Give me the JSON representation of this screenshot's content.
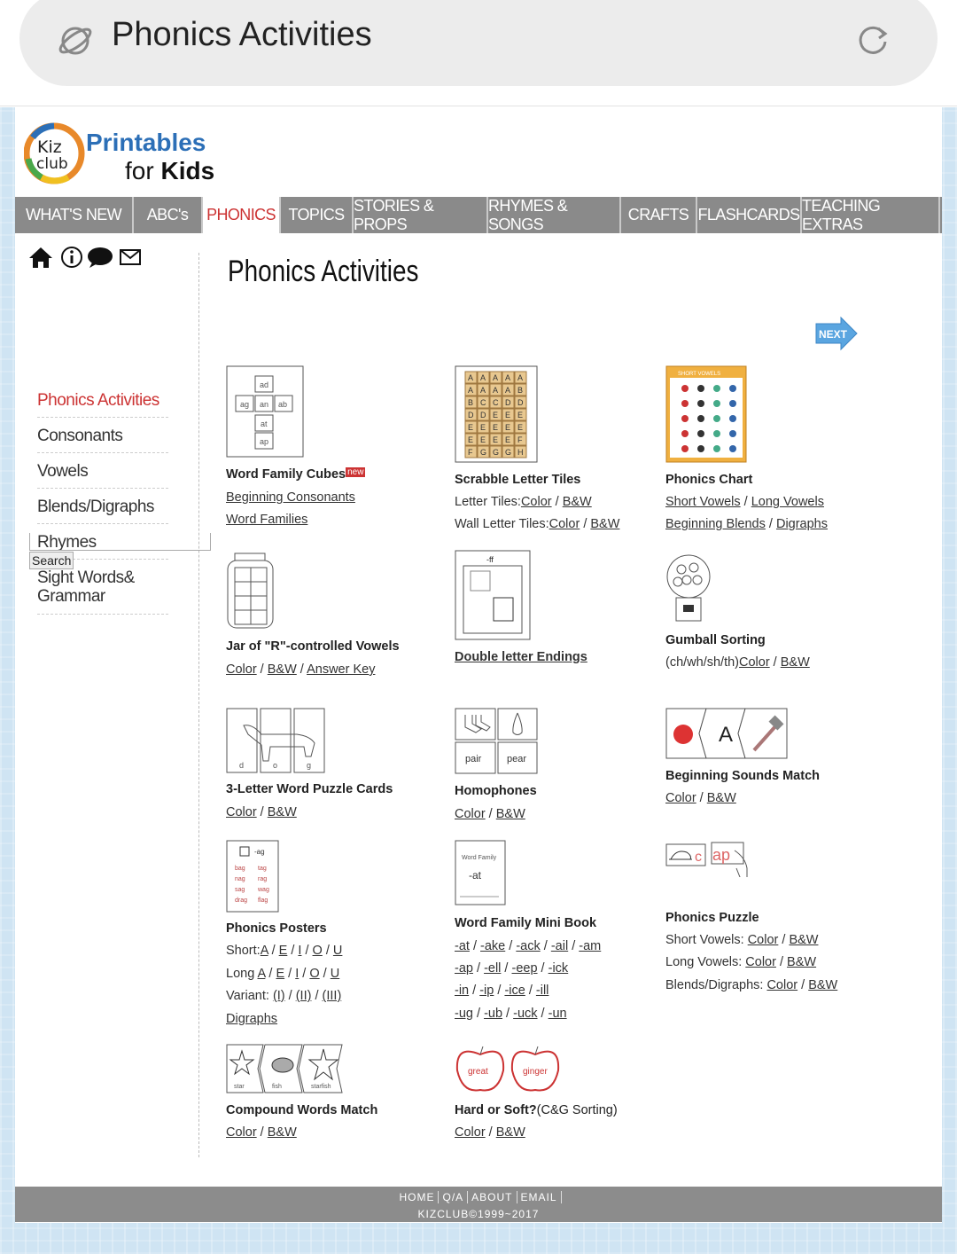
{
  "browser": {
    "query": "Phonics Activities",
    "planet_icon": "planet-icon",
    "reload_icon": "reload-icon"
  },
  "logo": {
    "badge": "Kiz club",
    "line1": "Printables",
    "line2_a": "for ",
    "line2_b": "Kids"
  },
  "nav": [
    {
      "label": "WHAT'S NEW",
      "w": 134
    },
    {
      "label": "ABC's",
      "w": 78
    },
    {
      "label": "PHONICS",
      "w": 88,
      "active": true
    },
    {
      "label": "TOPICS",
      "w": 82
    },
    {
      "label": "STORIES & PROPS",
      "w": 152
    },
    {
      "label": "RHYMES & SONGS",
      "w": 150
    },
    {
      "label": "CRAFTS",
      "w": 86
    },
    {
      "label": "FLASHCARDS",
      "w": 118
    },
    {
      "label": "TEACHING EXTRAS",
      "w": 156
    }
  ],
  "sidebar": {
    "icons": [
      "home-icon",
      "info-icon",
      "speech-bubble-icon",
      "mail-icon"
    ],
    "items": [
      {
        "label": "Phonics Activities",
        "active": true
      },
      {
        "label": "Consonants"
      },
      {
        "label": "Vowels"
      },
      {
        "label": "Blends/Digraphs"
      },
      {
        "label": "Rhymes"
      },
      {
        "label": "Sight Words& Grammar"
      }
    ],
    "search_value": "",
    "search_button": "Search"
  },
  "main": {
    "title": "Phonics Activities",
    "next_label": "NEXT"
  },
  "cards": [
    {
      "title": "Word Family Cubes",
      "badge": "new",
      "thumb": "cube",
      "lines": [
        {
          "prefix": "",
          "links": [
            "Beginning Consonants"
          ]
        },
        {
          "prefix": "",
          "links": [
            "Word Families"
          ]
        }
      ]
    },
    {
      "title": "Scrabble Letter Tiles",
      "thumb": "tiles",
      "lines": [
        {
          "prefix": "Letter Tiles:",
          "links": [
            "Color",
            "B&W"
          ]
        },
        {
          "prefix": "Wall Letter Tiles:",
          "links": [
            "Color",
            "B&W"
          ]
        }
      ]
    },
    {
      "title": "Phonics Chart",
      "thumb": "chart",
      "chart_label": "SHORT VOWELS",
      "lines": [
        {
          "prefix": "",
          "links": [
            "Short Vowels",
            "Long Vowels"
          ]
        },
        {
          "prefix": "",
          "links": [
            "Beginning Blends",
            "Digraphs"
          ]
        }
      ]
    },
    {
      "title": "Jar of \"R\"-controlled Vowels",
      "thumb": "jar",
      "lines": [
        {
          "prefix": "",
          "links": [
            "Color",
            "B&W",
            "Answer Key"
          ]
        }
      ]
    },
    {
      "title": "Double letter Endings",
      "title_link": true,
      "thumb": "double",
      "thumb_label": "-ff",
      "lines": []
    },
    {
      "title": "Gumball Sorting",
      "thumb": "gumball",
      "lines": [
        {
          "prefix": "(ch/wh/sh/th)",
          "links": [
            "Color",
            "B&W"
          ]
        }
      ]
    },
    {
      "title": "3-Letter Word Puzzle Cards",
      "thumb": "dog",
      "thumb_letters": [
        "d",
        "o",
        "g"
      ],
      "lines": [
        {
          "prefix": "",
          "links": [
            "Color",
            "B&W"
          ]
        }
      ]
    },
    {
      "title": "Homophones",
      "thumb": "homo",
      "thumb_words": [
        "pair",
        "pear"
      ],
      "lines": [
        {
          "prefix": "",
          "links": [
            "Color",
            "B&W"
          ]
        }
      ]
    },
    {
      "title": "Beginning Sounds Match",
      "thumb": "match",
      "thumb_letter": "A",
      "lines": [
        {
          "prefix": "",
          "links": [
            "Color",
            "B&W"
          ]
        }
      ]
    },
    {
      "title": "Phonics Posters",
      "thumb": "poster",
      "thumb_label": "-ag",
      "thumb_words": [
        "bag",
        "tag",
        "nag",
        "rag",
        "sag",
        "wag",
        "drag",
        "flag"
      ],
      "lines": [
        {
          "prefix": "Short:",
          "links": [
            "A",
            "E",
            "I",
            "O",
            "U"
          ]
        },
        {
          "prefix": "Long ",
          "links": [
            "A",
            "E",
            "I",
            "O",
            "U"
          ]
        },
        {
          "prefix": "Variant: ",
          "links": [
            "(I)",
            "(II)",
            "(III)"
          ]
        },
        {
          "prefix": "",
          "links": [
            "Digraphs"
          ]
        }
      ]
    },
    {
      "title": "Word Family Mini Book",
      "thumb": "book",
      "thumb_words": [
        "Word Family",
        "-at"
      ],
      "lines": [
        {
          "prefix": "",
          "links": [
            "-at",
            "-ake",
            "-ack",
            "-ail",
            "-am"
          ]
        },
        {
          "prefix": "",
          "links": [
            "-ap",
            "-ell",
            "-eep",
            "-ick"
          ]
        },
        {
          "prefix": "",
          "links": [
            "-in",
            "-ip",
            "-ice",
            "-ill"
          ]
        },
        {
          "prefix": "",
          "links": [
            "-ug",
            "-ub",
            "-uck",
            "-un"
          ]
        }
      ]
    },
    {
      "title": "Phonics Puzzle",
      "thumb": "puzzle",
      "thumb_words": [
        "c",
        "ap"
      ],
      "lines": [
        {
          "prefix": "Short Vowels: ",
          "links": [
            "Color",
            "B&W"
          ]
        },
        {
          "prefix": "Long Vowels: ",
          "links": [
            "Color",
            "B&W"
          ]
        },
        {
          "prefix": "Blends/Digraphs: ",
          "links": [
            "Color",
            "B&W"
          ]
        }
      ]
    },
    {
      "title": "Compound Words Match",
      "thumb": "compound",
      "thumb_words": [
        "star",
        "fish",
        "starfish"
      ],
      "lines": [
        {
          "prefix": "",
          "links": [
            "Color",
            "B&W"
          ]
        }
      ]
    },
    {
      "title": "Hard or Soft?",
      "suffix": "(C&G Sorting)",
      "thumb": "apples",
      "thumb_words": [
        "great",
        "ginger"
      ],
      "lines": [
        {
          "prefix": "",
          "links": [
            "Color",
            "B&W"
          ]
        }
      ]
    }
  ],
  "footer": {
    "links": [
      "HOME",
      "Q/A",
      "ABOUT",
      "EMAIL"
    ],
    "copyright": "KIZCLUB©1999~2017"
  }
}
